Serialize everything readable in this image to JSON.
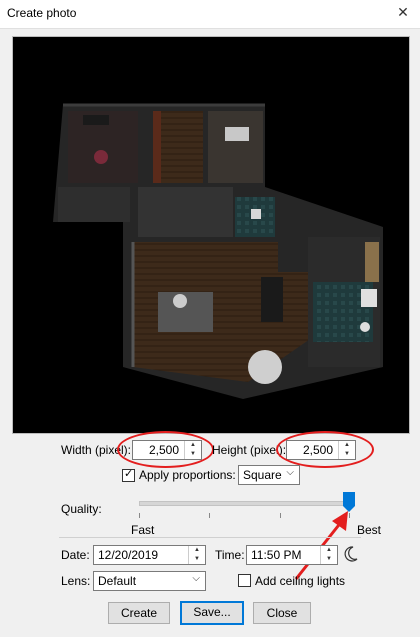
{
  "window": {
    "title": "Create photo",
    "close_glyph": "✕"
  },
  "size": {
    "width_label": "Width (pixel):",
    "width_value": "2,500",
    "height_label": "Height (pixel):",
    "height_value": "2,500"
  },
  "proportions": {
    "checkbox_label": "Apply proportions:",
    "checked": true,
    "selected": "Square"
  },
  "quality": {
    "label": "Quality:",
    "fast_label": "Fast",
    "best_label": "Best",
    "level_fraction": 1.0
  },
  "datetime": {
    "date_label": "Date:",
    "date_value": "12/20/2019",
    "time_label": "Time:",
    "time_value": "11:50 PM"
  },
  "lens": {
    "label": "Lens:",
    "selected": "Default",
    "ceiling_lights_label": "Add ceiling lights",
    "ceiling_lights_checked": false
  },
  "buttons": {
    "create": "Create",
    "save": "Save...",
    "close": "Close"
  },
  "colors": {
    "annotation_red": "#e31e1e",
    "accent_blue": "#0078d7"
  }
}
